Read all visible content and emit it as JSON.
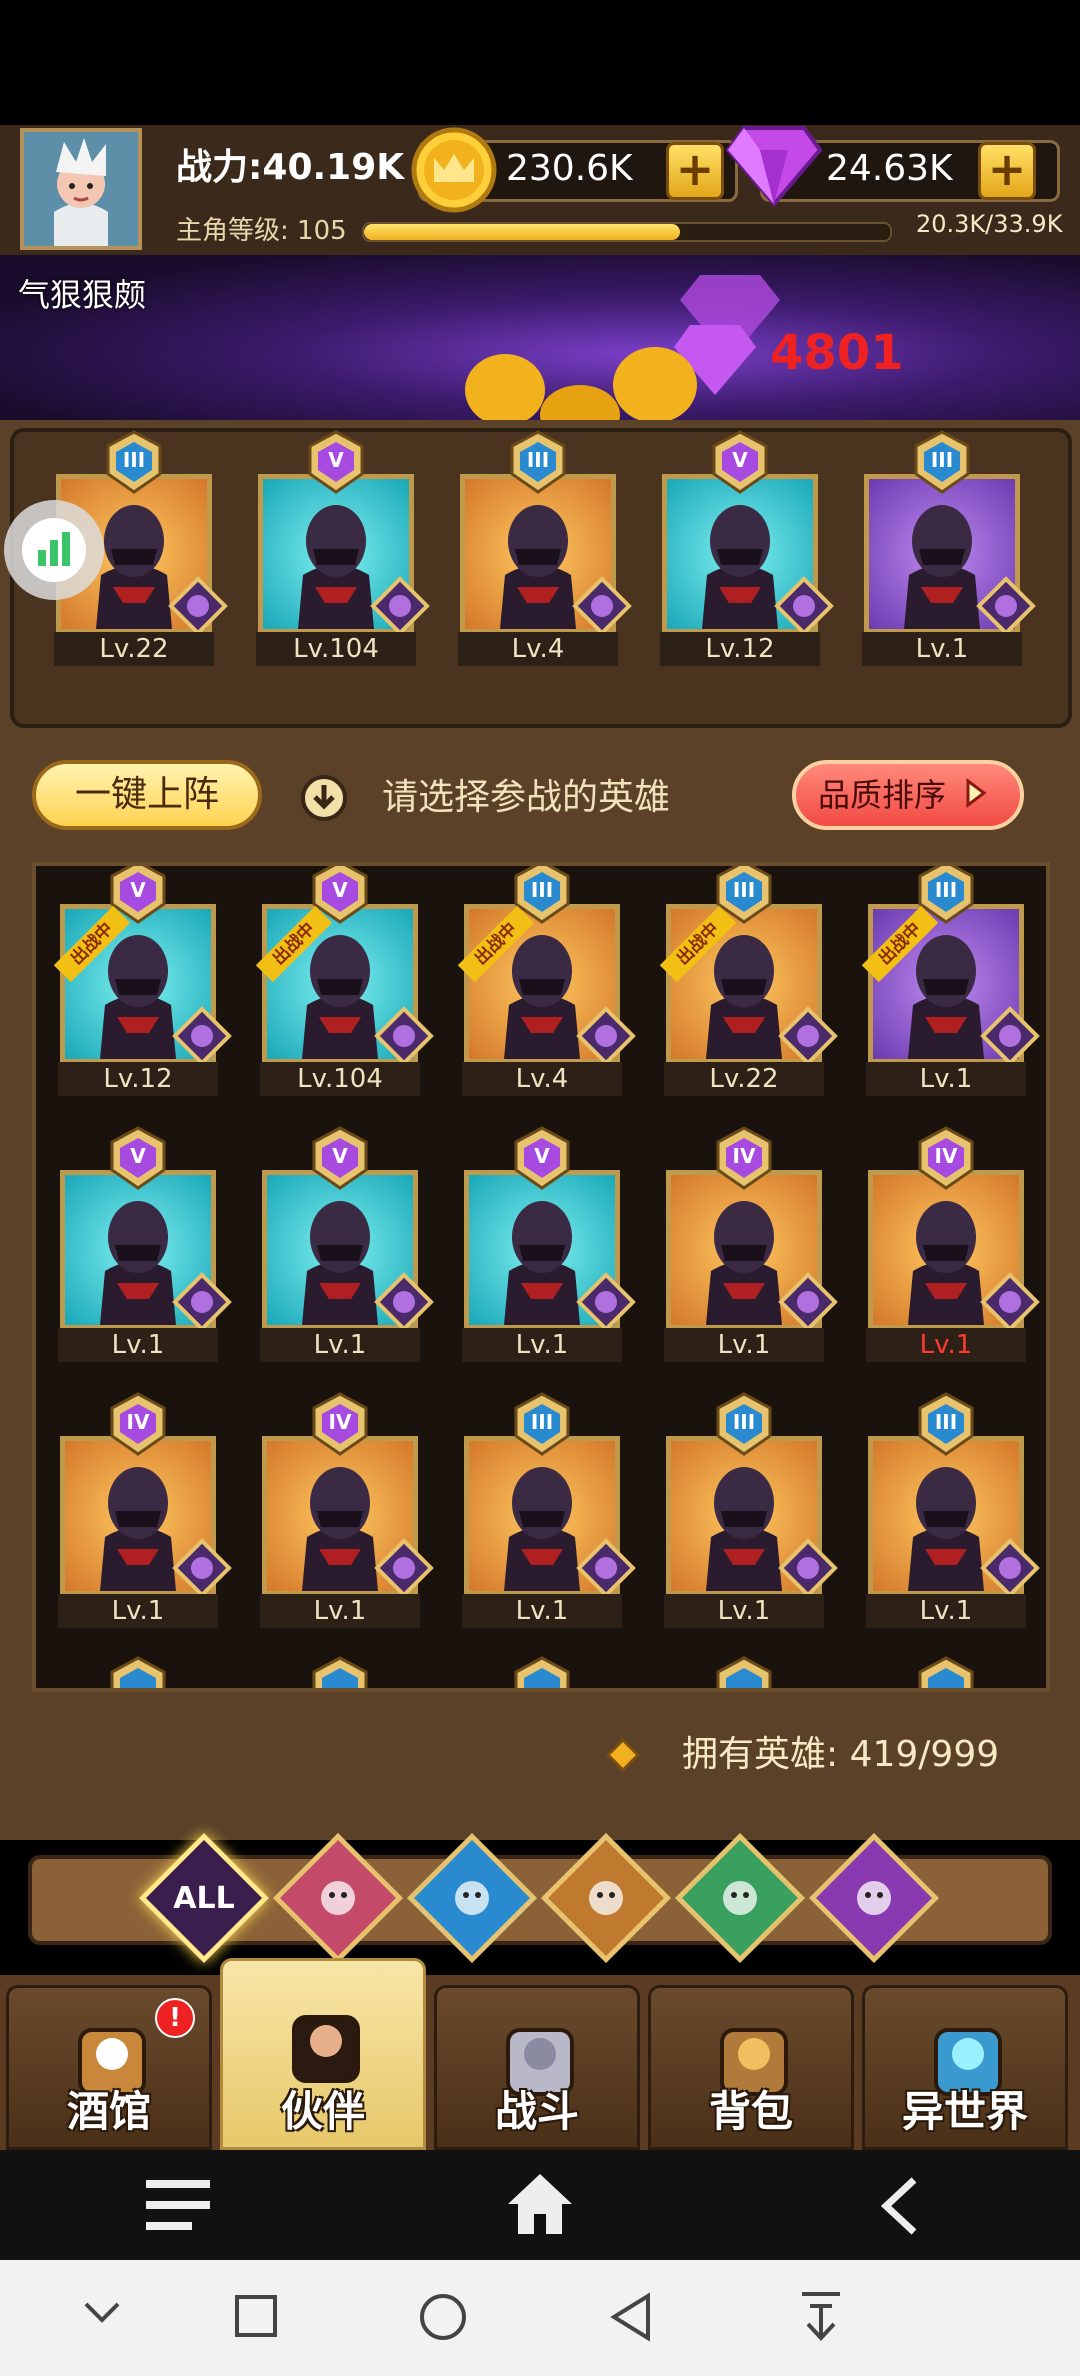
{
  "header": {
    "power": "战力:40.19K",
    "level_label": "主角等级: 105",
    "xp_text": "20.3K/33.9K",
    "xp_progress": 0.6,
    "gold": "230.6K",
    "gems": "24.63K"
  },
  "banner": {
    "nickname": "气狠狠颇",
    "float_number": "4801"
  },
  "team": [
    {
      "level": "Lv.22",
      "rank": "III",
      "bg": "gold"
    },
    {
      "level": "Lv.104",
      "rank": "V",
      "bg": "cyan"
    },
    {
      "level": "Lv.4",
      "rank": "III",
      "bg": "gold"
    },
    {
      "level": "Lv.12",
      "rank": "V",
      "bg": "cyan"
    },
    {
      "level": "Lv.1",
      "rank": "III",
      "bg": "purple"
    }
  ],
  "actions": {
    "auto_deploy": "一键上阵",
    "hint": "请选择参战的英雄",
    "sort": "品质排序"
  },
  "roster": [
    {
      "level": "Lv.12",
      "rank": "V",
      "bg": "cyan",
      "deployed": true
    },
    {
      "level": "Lv.104",
      "rank": "V",
      "bg": "cyan",
      "deployed": true
    },
    {
      "level": "Lv.4",
      "rank": "III",
      "bg": "gold",
      "deployed": true
    },
    {
      "level": "Lv.22",
      "rank": "III",
      "bg": "gold",
      "deployed": true
    },
    {
      "level": "Lv.1",
      "rank": "III",
      "bg": "purple",
      "deployed": true
    },
    {
      "level": "Lv.1",
      "rank": "V",
      "bg": "cyan"
    },
    {
      "level": "Lv.1",
      "rank": "V",
      "bg": "cyan"
    },
    {
      "level": "Lv.1",
      "rank": "V",
      "bg": "cyan"
    },
    {
      "level": "Lv.1",
      "rank": "IV",
      "bg": "gold"
    },
    {
      "level": "Lv.1",
      "rank": "IV",
      "bg": "gold",
      "red": true
    },
    {
      "level": "Lv.1",
      "rank": "IV",
      "bg": "gold"
    },
    {
      "level": "Lv.1",
      "rank": "IV",
      "bg": "gold"
    },
    {
      "level": "Lv.1",
      "rank": "III",
      "bg": "gold"
    },
    {
      "level": "Lv.1",
      "rank": "III",
      "bg": "gold"
    },
    {
      "level": "Lv.1",
      "rank": "III",
      "bg": "gold"
    }
  ],
  "deployed_label": "出战中",
  "owned": "拥有英雄: 419/999",
  "filters": [
    "ALL",
    "crown-warrior-icon",
    "fishman-icon",
    "lion-icon",
    "elf-icon",
    "demon-icon"
  ],
  "filter_all_label": "ALL",
  "tabs": [
    {
      "label": "酒馆",
      "icon": "beer-mug-icon",
      "alert": "!"
    },
    {
      "label": "伙伴",
      "icon": "partner-icon",
      "active": true
    },
    {
      "label": "战斗",
      "icon": "crossed-swords-icon"
    },
    {
      "label": "背包",
      "icon": "backpack-icon"
    },
    {
      "label": "异世界",
      "icon": "portal-icon"
    }
  ],
  "colors": {
    "gold": "#ffd24a",
    "gem": "#b040e0",
    "red_button": "#f24a44"
  }
}
